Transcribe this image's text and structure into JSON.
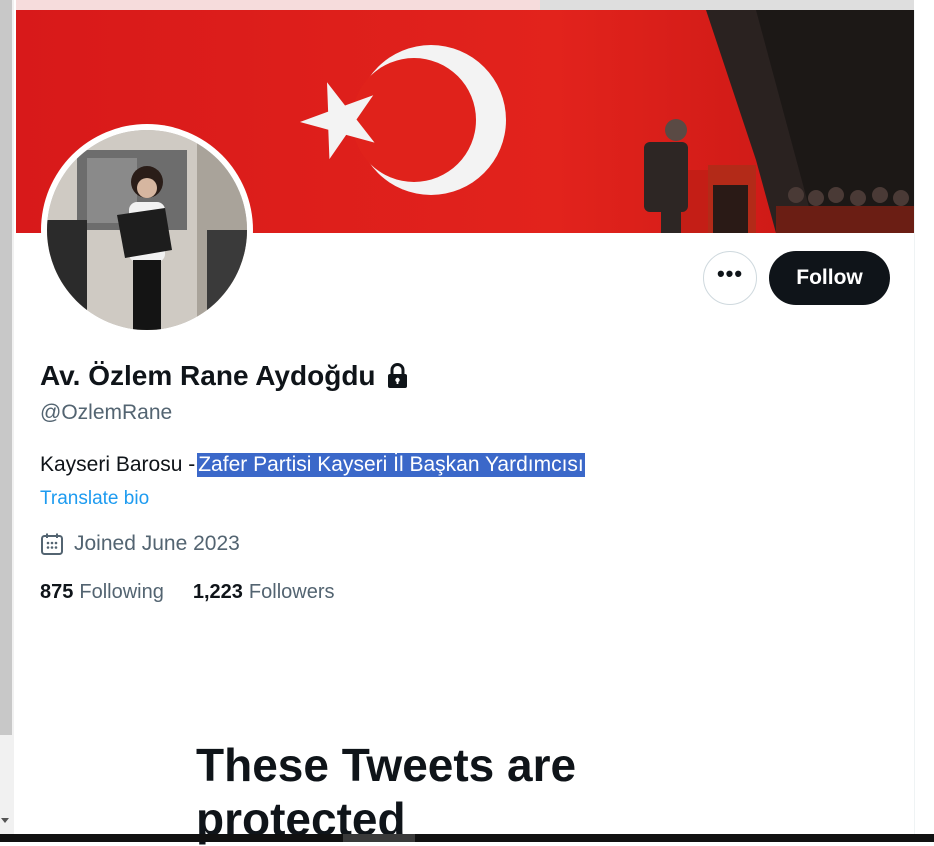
{
  "profile": {
    "display_name": "Av. Özlem Rane Aydoğdu",
    "handle": "@OzlemRane",
    "protected_icon": "lock-icon",
    "bio_plain": "Kayseri Barosu -",
    "bio_selected": "Zafer Partisi Kayseri İl Başkan Yardımcısı",
    "translate_bio": "Translate bio",
    "joined": "Joined June 2023",
    "joined_icon": "calendar-icon"
  },
  "actions": {
    "more_icon": "more-icon",
    "more_label": "•••",
    "follow_label": "Follow"
  },
  "stats": {
    "following_count": "875",
    "following_label": "Following",
    "followers_count": "1,223",
    "followers_label": "Followers"
  },
  "protected_message": {
    "heading": "These Tweets are protected"
  },
  "colors": {
    "banner_red": "#d61a16",
    "link_blue": "#1d9bf0",
    "selection_blue": "#3b68c9",
    "button_dark": "#0f1419",
    "secondary_text": "#536471"
  }
}
